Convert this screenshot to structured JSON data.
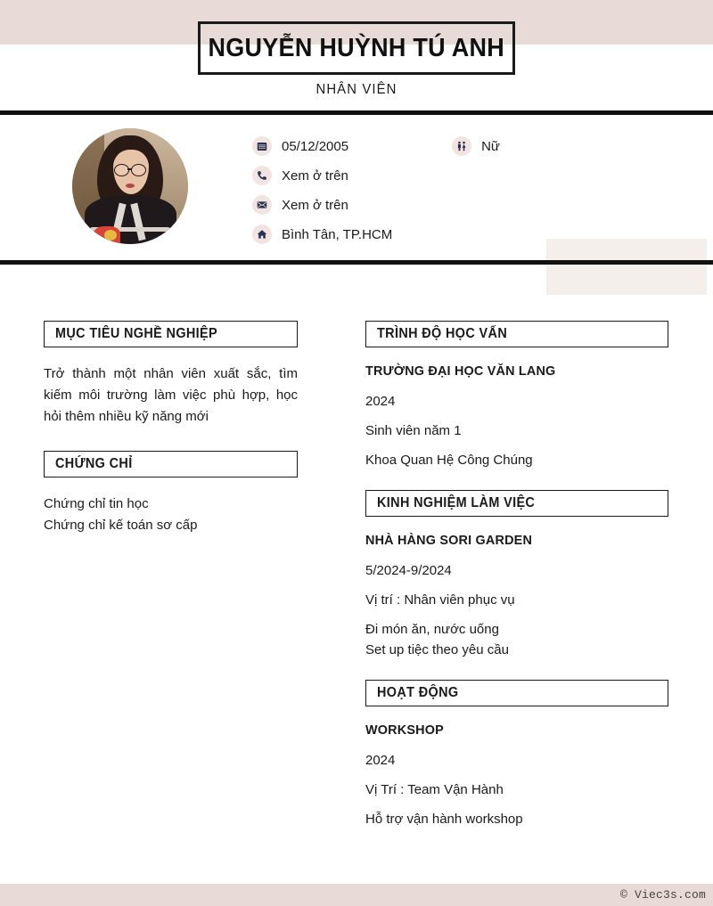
{
  "header": {
    "name": "NGUYỄN HUỲNH TÚ ANH",
    "job_title": "NHÂN VIÊN"
  },
  "contact": {
    "birthdate": "05/12/2005",
    "gender": "Nữ",
    "phone": "Xem ở trên",
    "email": "Xem ở trên",
    "address": "Bình Tân, TP.HCM",
    "icons": {
      "birthdate": "calendar-icon",
      "gender": "gender-icon",
      "phone": "phone-icon",
      "email": "envelope-icon",
      "address": "home-icon"
    }
  },
  "left_column": {
    "objective": {
      "heading": "MỤC TIÊU NGHỀ NGHIỆP",
      "body": "Trở thành một nhân viên xuất sắc, tìm kiếm môi trường làm việc phù hợp, học hỏi thêm nhiều kỹ năng mới"
    },
    "certificates": {
      "heading": "CHỨNG CHỈ",
      "items": [
        "Chứng chỉ tin học",
        "Chứng chỉ kế toán sơ cấp"
      ]
    }
  },
  "right_column": {
    "education": {
      "heading": "TRÌNH ĐỘ HỌC VẤN",
      "entries": [
        {
          "title": "TRƯỜNG ĐẠI HỌC VĂN LANG",
          "year": "2024",
          "role": " Sinh viên năm 1",
          "detail": "Khoa Quan Hệ Công Chúng"
        }
      ]
    },
    "experience": {
      "heading": "KINH NGHIỆM LÀM VIỆC",
      "entries": [
        {
          "title": "NHÀ HÀNG SORI GARDEN",
          "period": "5/2024-9/2024",
          "role": "Vị trí : Nhân viên phục vụ",
          "duties": [
            "Đi món ăn, nước uống",
            "Set up tiệc theo yêu cầu"
          ]
        }
      ]
    },
    "activities": {
      "heading": "HOẠT ĐỘNG",
      "entries": [
        {
          "title": "WORKSHOP",
          "year": "2024",
          "role": "Vị Trí : Team Vận Hành",
          "detail": "Hỗ trợ vận hành workshop"
        }
      ]
    }
  },
  "footer": {
    "watermark": "© Viec3s.com"
  },
  "colors": {
    "banner_pink": "#e8dad7",
    "accent_block": "#f5efec",
    "icon_bg": "#f2e4e1",
    "icon_fg": "#2b3050",
    "rule": "#111111"
  }
}
